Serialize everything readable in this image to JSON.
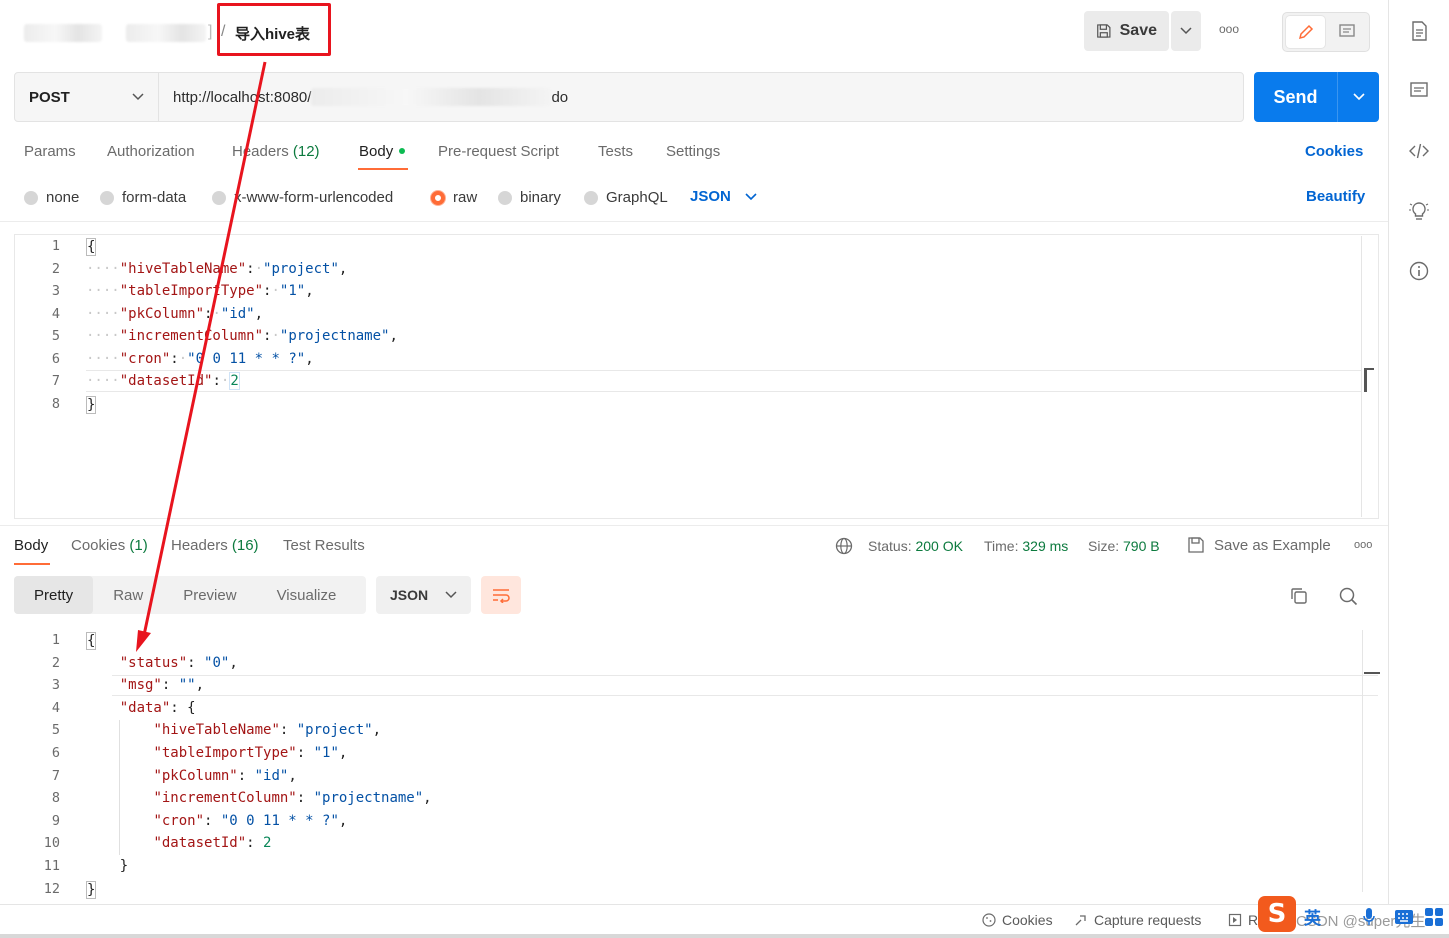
{
  "header": {
    "breadcrumb_sep": "/",
    "breadcrumb_active": "导入hive表",
    "save_label": "Save",
    "more_label": "ooo"
  },
  "request": {
    "method": "POST",
    "url_prefix": "http://localhost:8080/",
    "url_suffix": "do",
    "send_label": "Send"
  },
  "request_tabs": [
    {
      "label": "Params"
    },
    {
      "label": "Authorization"
    },
    {
      "label": "Headers",
      "count": "(12)"
    },
    {
      "label": "Body"
    },
    {
      "label": "Pre-request Script"
    },
    {
      "label": "Tests"
    },
    {
      "label": "Settings"
    }
  ],
  "cookies_link": "Cookies",
  "beautify_link": "Beautify",
  "body_types": [
    "none",
    "form-data",
    "x-www-form-urlencoded",
    "raw",
    "binary",
    "GraphQL"
  ],
  "body_format": "JSON",
  "request_body": {
    "line_numbers": [
      "1",
      "2",
      "3",
      "4",
      "5",
      "6",
      "7",
      "8"
    ],
    "keys": [
      "\"hiveTableName\"",
      "\"tableImportType\"",
      "\"pkColumn\"",
      "\"incrementColumn\"",
      "\"cron\"",
      "\"datasetId\""
    ],
    "values": [
      "\"project\"",
      "\"1\"",
      "\"id\"",
      "\"projectname\"",
      "\"0 0 11 * * ?\"",
      "2"
    ]
  },
  "response_tabs": [
    {
      "label": "Body"
    },
    {
      "label": "Cookies",
      "count": "(1)"
    },
    {
      "label": "Headers",
      "count": "(16)"
    },
    {
      "label": "Test Results"
    }
  ],
  "response_meta": {
    "status_label": "Status:",
    "status_value": "200 OK",
    "time_label": "Time:",
    "time_value": "329 ms",
    "size_label": "Size:",
    "size_value": "790 B",
    "save_example": "Save as Example"
  },
  "response_views": [
    "Pretty",
    "Raw",
    "Preview",
    "Visualize"
  ],
  "response_format": "JSON",
  "response_body": {
    "line_numbers": [
      "1",
      "2",
      "3",
      "4",
      "5",
      "6",
      "7",
      "8",
      "9",
      "10",
      "11",
      "12"
    ],
    "status_key": "\"status\"",
    "status_val": "\"0\"",
    "msg_key": "\"msg\"",
    "msg_val": "\"\"",
    "data_key": "\"data\"",
    "keys": [
      "\"hiveTableName\"",
      "\"tableImportType\"",
      "\"pkColumn\"",
      "\"incrementColumn\"",
      "\"cron\"",
      "\"datasetId\""
    ],
    "values": [
      "\"project\"",
      "\"1\"",
      "\"id\"",
      "\"projectname\"",
      "\"0 0 11 * * ?\"",
      "2"
    ]
  },
  "statusbar": {
    "cookies": "Cookies",
    "capture": "Capture requests",
    "runner": "Ru",
    "watermark": "CSDN @super先生",
    "ime": "英"
  },
  "colors": {
    "accent": "#ff6c37",
    "send_blue": "#097bed",
    "link_blue": "#0265d2",
    "annotation_red": "#e8141e",
    "status_green": "#0c7a3e"
  }
}
